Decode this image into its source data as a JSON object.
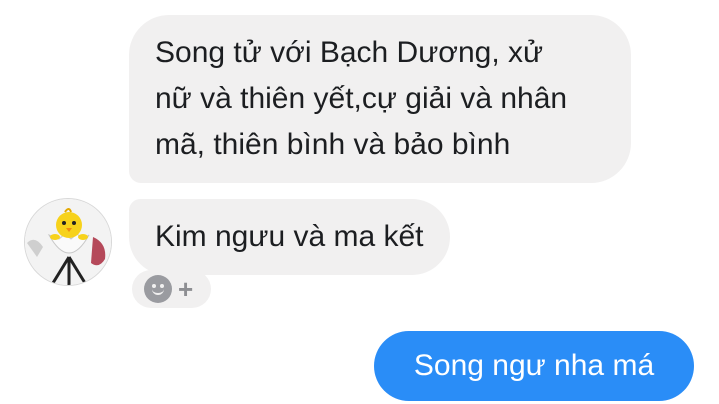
{
  "messages": [
    {
      "direction": "incoming",
      "text": "Song tử với Bạch Dương, xử\nnữ và thiên yết,cự giải và nhân\nmã, thiên bình và bảo bình"
    },
    {
      "direction": "incoming",
      "text": "Kim ngưu và ma kết"
    },
    {
      "direction": "outgoing",
      "text": "Song ngư nha má"
    }
  ],
  "reaction_button": {
    "icon": "smiley-icon",
    "plus": "+"
  },
  "avatar": {
    "icon": "chick-avatar-icon"
  },
  "colors": {
    "incoming_bubble": "#f1f0f0",
    "outgoing_bubble": "#2a8df7",
    "text": "#1c1e21",
    "outgoing_text": "#ffffff"
  }
}
